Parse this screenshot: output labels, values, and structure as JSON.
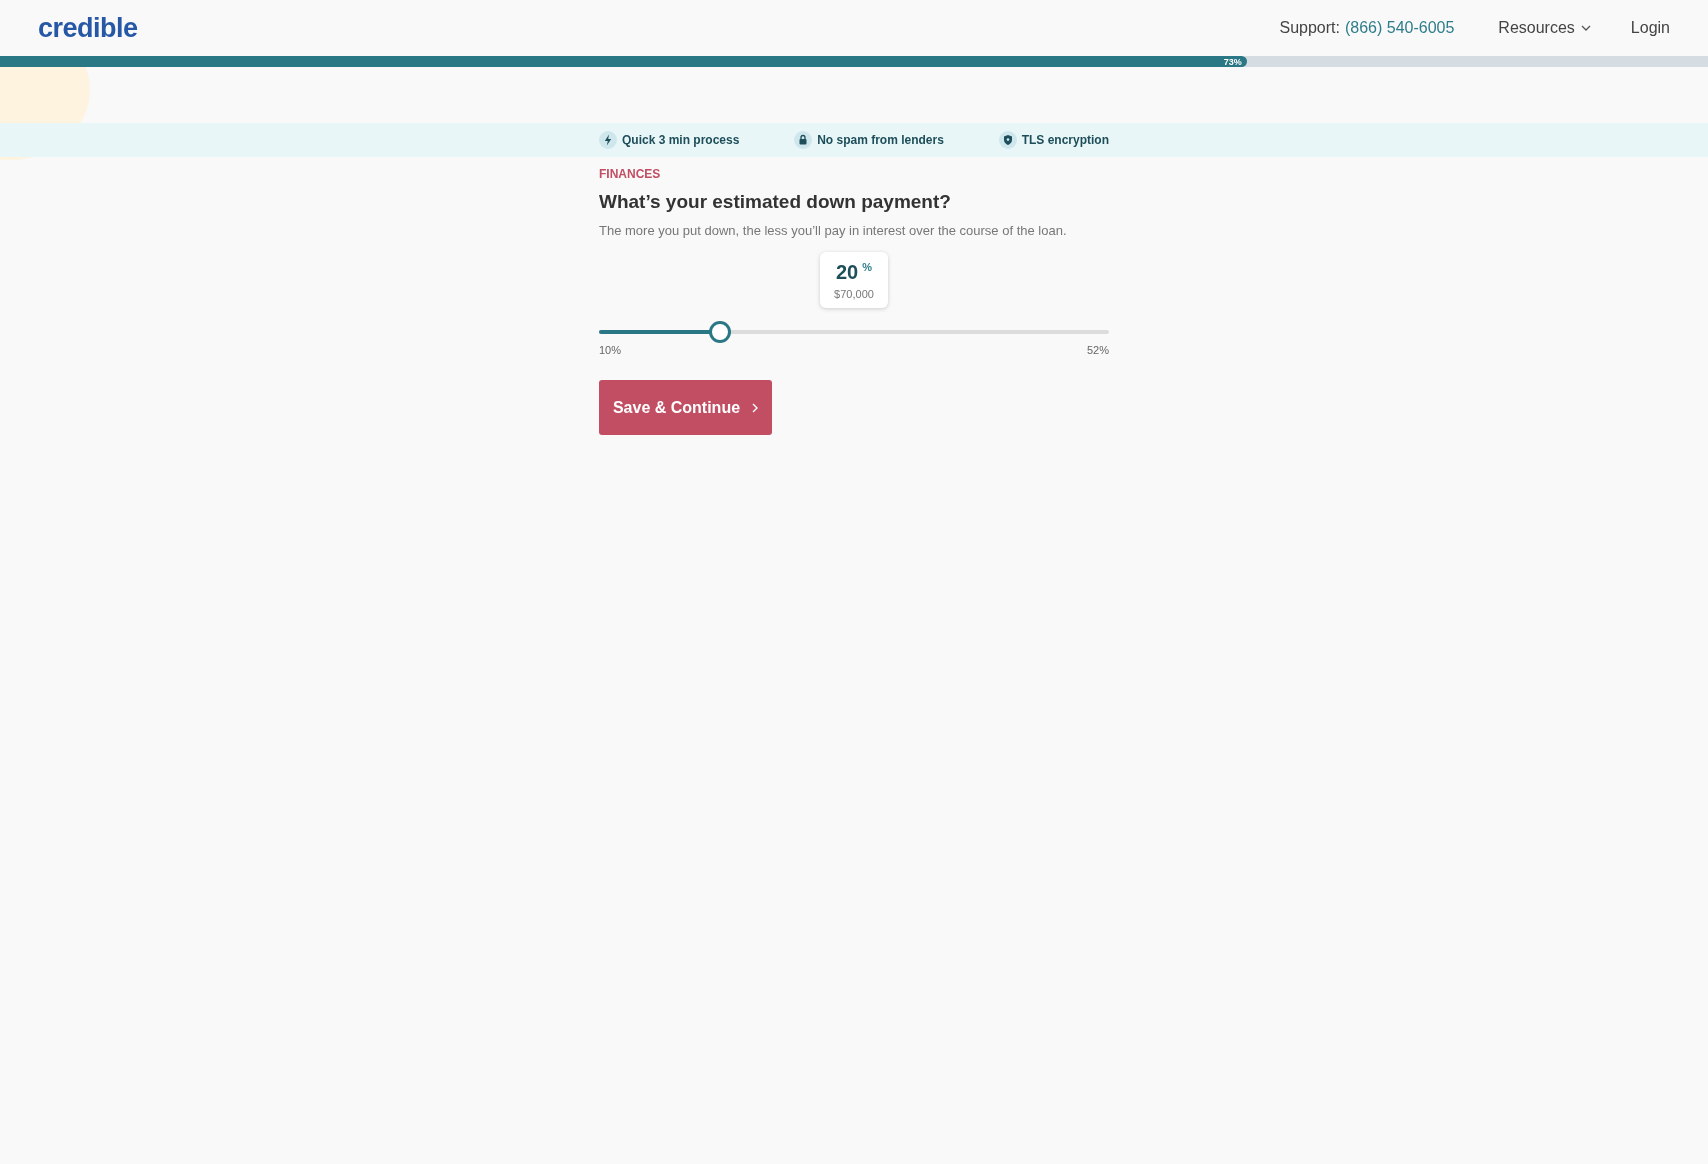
{
  "header": {
    "logo": "credible",
    "support_label": "Support:",
    "support_phone": "(866) 540-6005",
    "nav": [
      {
        "label": "Resources",
        "kind": "dropdown"
      },
      {
        "label": "Login",
        "kind": "link"
      }
    ]
  },
  "progress": {
    "level": 0.73,
    "label": "73%"
  },
  "trust_items": [
    {
      "kind": "bolt",
      "label": "Quick 3 min process"
    },
    {
      "kind": "lock",
      "label": "No spam from lenders"
    },
    {
      "kind": "shield",
      "label": "TLS encryption"
    }
  ],
  "section": "FINANCES",
  "question": "What’s your estimated down payment?",
  "description": "The more you put down, the less you’ll pay in interest over the course of the loan.",
  "slider": {
    "value": "20",
    "unit": "%",
    "amount": "$70,000",
    "level": 0.238,
    "min_label": "10%",
    "max_label": "52%"
  },
  "button": {
    "label": "Save & Continue"
  }
}
